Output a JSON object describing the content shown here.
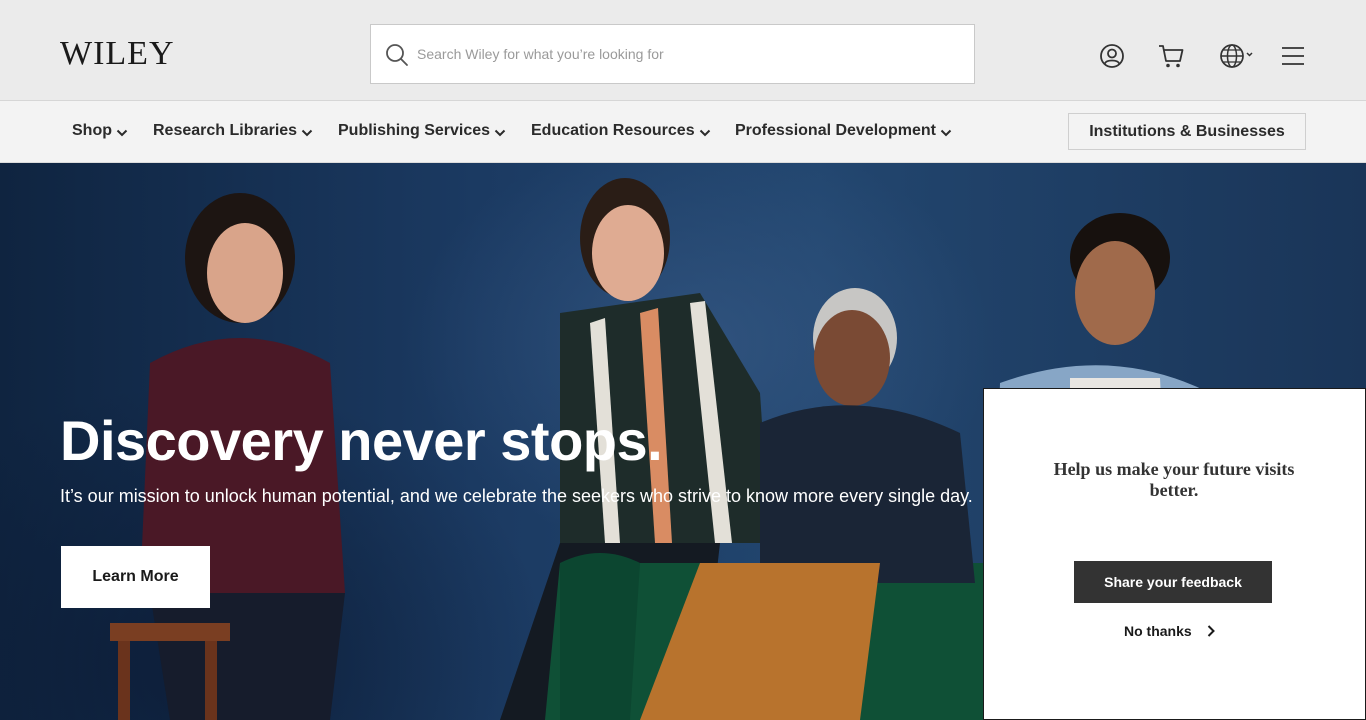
{
  "header": {
    "logo_text": "WILEY",
    "search": {
      "placeholder": "Search Wiley for what you’re looking for",
      "value": ""
    },
    "icons": [
      "search-icon",
      "account-icon",
      "cart-icon",
      "globe-icon",
      "menu-icon"
    ]
  },
  "nav": {
    "items": [
      {
        "label": "Shop"
      },
      {
        "label": "Research Libraries"
      },
      {
        "label": "Publishing Services"
      },
      {
        "label": "Education Resources"
      },
      {
        "label": "Professional Development"
      }
    ],
    "institutions_label": "Institutions & Businesses"
  },
  "hero": {
    "title": "Discovery never stops.",
    "subtitle": "It’s our mission to unlock human potential, and we celebrate the seekers who strive to know more every single day.",
    "cta_label": "Learn More"
  },
  "feedback": {
    "title": "Help us make your future visits better.",
    "share_label": "Share your feedback",
    "dismiss_label": "No thanks"
  },
  "colors": {
    "header_bg": "#ebebeb",
    "nav_bg": "#f3f3f3",
    "hero_bg": "#1b3a62",
    "button_dark": "#333333"
  }
}
